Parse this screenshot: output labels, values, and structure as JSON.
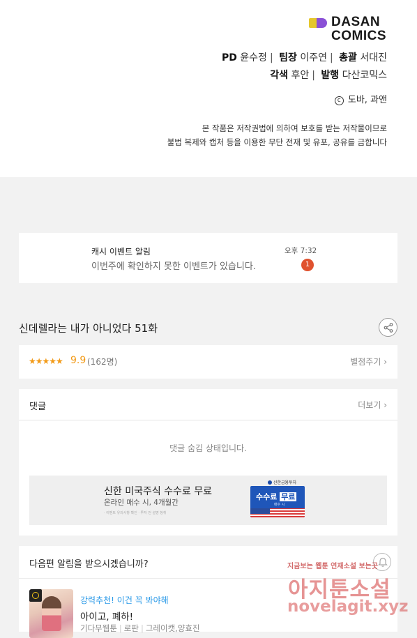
{
  "credits": {
    "logo_line1": "DASAN",
    "logo_line2": "COMICS",
    "pd_label": "PD",
    "pd_name": "윤수정",
    "lead_label": "팀장",
    "lead_name": "이주연",
    "chief_label": "총괄",
    "chief_name": "서대진",
    "adapt_label": "각색",
    "adapt_name": "후안",
    "publish_label": "발행",
    "publish_name": "다산코믹스",
    "copyright": "도바, 과앤",
    "notice_line1": "본 작품은 저작권법에 의하여 보호를 받는 저작물이므로",
    "notice_line2": "불법 복제와 캡처 등을 이용한 무단 전재 및 유포, 공유를 금합니다"
  },
  "notification": {
    "title": "캐시 이벤트 알림",
    "body": "이번주에 확인하지 못한 이벤트가 있습니다.",
    "time": "오후 7:32",
    "badge": "1"
  },
  "episode": {
    "title": "신데렐라는 내가 아니었다 51화"
  },
  "rating": {
    "stars": "★★★★★",
    "score": "9.9",
    "count": "(162명)",
    "rate_label": "별점주기 ›"
  },
  "comments": {
    "title": "댓글",
    "more": "더보기 ›",
    "hidden_msg": "댓글 숨김 상태입니다."
  },
  "ad": {
    "brand": "신한금융투자",
    "title": "신한 미국주식 수수료 무료",
    "subtitle": "온라인 매수 시, 4개월간",
    "fine_print": "· 이벤트 유의사항 확인 · 투자 전 설명 청취",
    "banner_text": "수수료",
    "banner_highlight": "무료",
    "banner_sub": "매수 시"
  },
  "next_episode": {
    "question": "다음편 알림을 받으시겠습니까?",
    "recommend": "강력추천! 이건 꼭 봐야해",
    "title": "아이고, 폐하!",
    "category": "기다무웹툰",
    "genre": "로판",
    "authors": "그레이캣,양효진"
  },
  "watermark": {
    "line1": "지금보는 웹툰 연재소설 보는곳",
    "line2": "아지툰소설",
    "line3": "novelagit.xyz"
  }
}
